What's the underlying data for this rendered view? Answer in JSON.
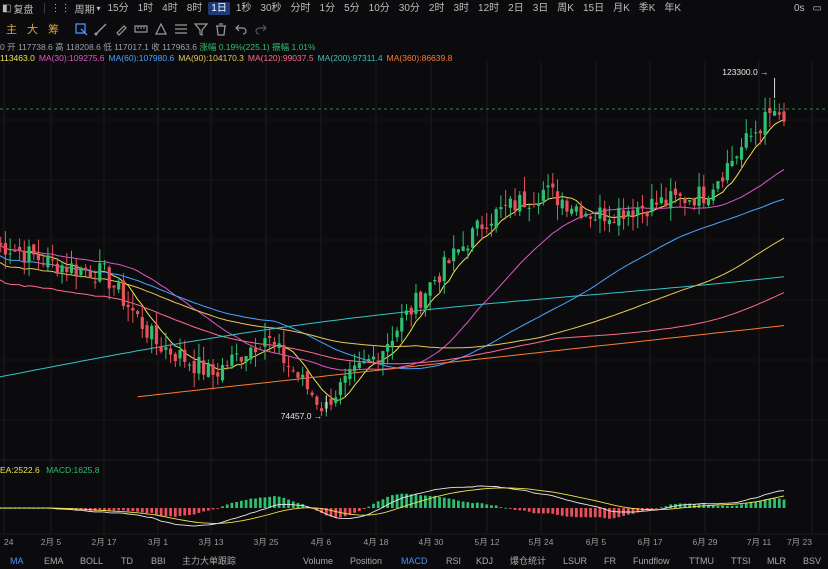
{
  "topbar": {
    "replay_label": "复盘",
    "period_label": "周期",
    "timeframes": [
      "15分",
      "1时",
      "4时",
      "8时",
      "1日",
      "1秒",
      "30秒",
      "分时",
      "1分",
      "5分",
      "10分",
      "30分",
      "2时",
      "3时",
      "12时",
      "2日",
      "3日",
      "周K",
      "15日",
      "月K",
      "季K",
      "年K"
    ],
    "active_timeframe": "1日",
    "countdown": "0s"
  },
  "toolbar": {
    "main_label": "主",
    "big_label": "大",
    "chips_label": "筹",
    "tools": [
      "select-icon",
      "draw-line-icon",
      "brush-icon",
      "ruler-icon",
      "shape-icon",
      "fib-icon",
      "filter-icon",
      "trash-icon",
      "undo-icon",
      "redo-icon"
    ]
  },
  "ohlc_info": {
    "open": "开 117738.6",
    "high": "高 118208.6",
    "low": "低 117017.1",
    "close": "收 117963.6",
    "change": "涨幅 0.19%(225.1)",
    "amplitude": "振幅 1.01%"
  },
  "ma_info": [
    {
      "text": "113463.0",
      "color": "#f0e44a"
    },
    {
      "text": "MA(30):109275.6",
      "color": "#e056c8"
    },
    {
      "text": "MA(60):107980.6",
      "color": "#4aa3ff"
    },
    {
      "text": "MA(90):104170.3",
      "color": "#e8c75a"
    },
    {
      "text": "MA(120):99037.5",
      "color": "#ff6b8b"
    },
    {
      "text": "MA(200):97311.4",
      "color": "#33c3c8"
    },
    {
      "text": "MA(360):86639.8",
      "color": "#ff7a30"
    }
  ],
  "macd_info": {
    "dea": "EA:2522.6",
    "macd": "MACD:1625.8"
  },
  "bottombar": {
    "indicators": [
      "MA",
      "EMA",
      "BOLL",
      "TD",
      "BBI",
      "主力大单跟踪",
      "Volume",
      "Position",
      "MACD",
      "RSI",
      "KDJ",
      "爆仓统计",
      "LSUR",
      "FR",
      "Fundflow",
      "TTMU",
      "TTSI",
      "MLR",
      "BSV"
    ],
    "active_indicator": "MACD"
  },
  "chart_data": {
    "type": "candlestick",
    "x_ticks": [
      "24",
      "2月 5",
      "2月 17",
      "3月 1",
      "3月 13",
      "3月 25",
      "4月 6",
      "4月 18",
      "4月 30",
      "5月 12",
      "5月 24",
      "6月 5",
      "6月 17",
      "6月 29",
      "7月 11",
      "7月 23"
    ],
    "annotations": [
      {
        "label": "123300.0",
        "kind": "high"
      },
      {
        "label": "74457.0",
        "kind": "low"
      }
    ],
    "price_range": [
      72000,
      126000
    ],
    "key_points": [
      {
        "x": "24",
        "price": 100000
      },
      {
        "x": "2月 5",
        "price": 97500
      },
      {
        "x": "2月 17",
        "price": 96000
      },
      {
        "x": "3月 1",
        "price": 86000
      },
      {
        "x": "3月 13",
        "price": 81500
      },
      {
        "x": "3月 25",
        "price": 87000
      },
      {
        "x": "4月 6",
        "price": 77000
      },
      {
        "x": "4月 18",
        "price": 84500
      },
      {
        "x": "4月 30",
        "price": 94500
      },
      {
        "x": "5月 12",
        "price": 104000
      },
      {
        "x": "5月 24",
        "price": 108000
      },
      {
        "x": "6月 5",
        "price": 104500
      },
      {
        "x": "6月 17",
        "price": 106000
      },
      {
        "x": "6月 29",
        "price": 107500
      },
      {
        "x": "7月 11",
        "price": 117500
      }
    ],
    "ma_series": [
      {
        "name": "MA(30)",
        "color": "#e056c8"
      },
      {
        "name": "MA(60)",
        "color": "#4aa3ff"
      },
      {
        "name": "MA(90)",
        "color": "#e8c75a"
      },
      {
        "name": "MA(120)",
        "color": "#ff6b8b"
      },
      {
        "name": "MA(200)",
        "color": "#33c3c8"
      },
      {
        "name": "MA(360)",
        "color": "#ff7a30"
      }
    ],
    "colors": {
      "up": "#2fbf71",
      "down": "#e9505a",
      "bg": "#0b0b0d",
      "grid": "#1c1c20"
    }
  }
}
